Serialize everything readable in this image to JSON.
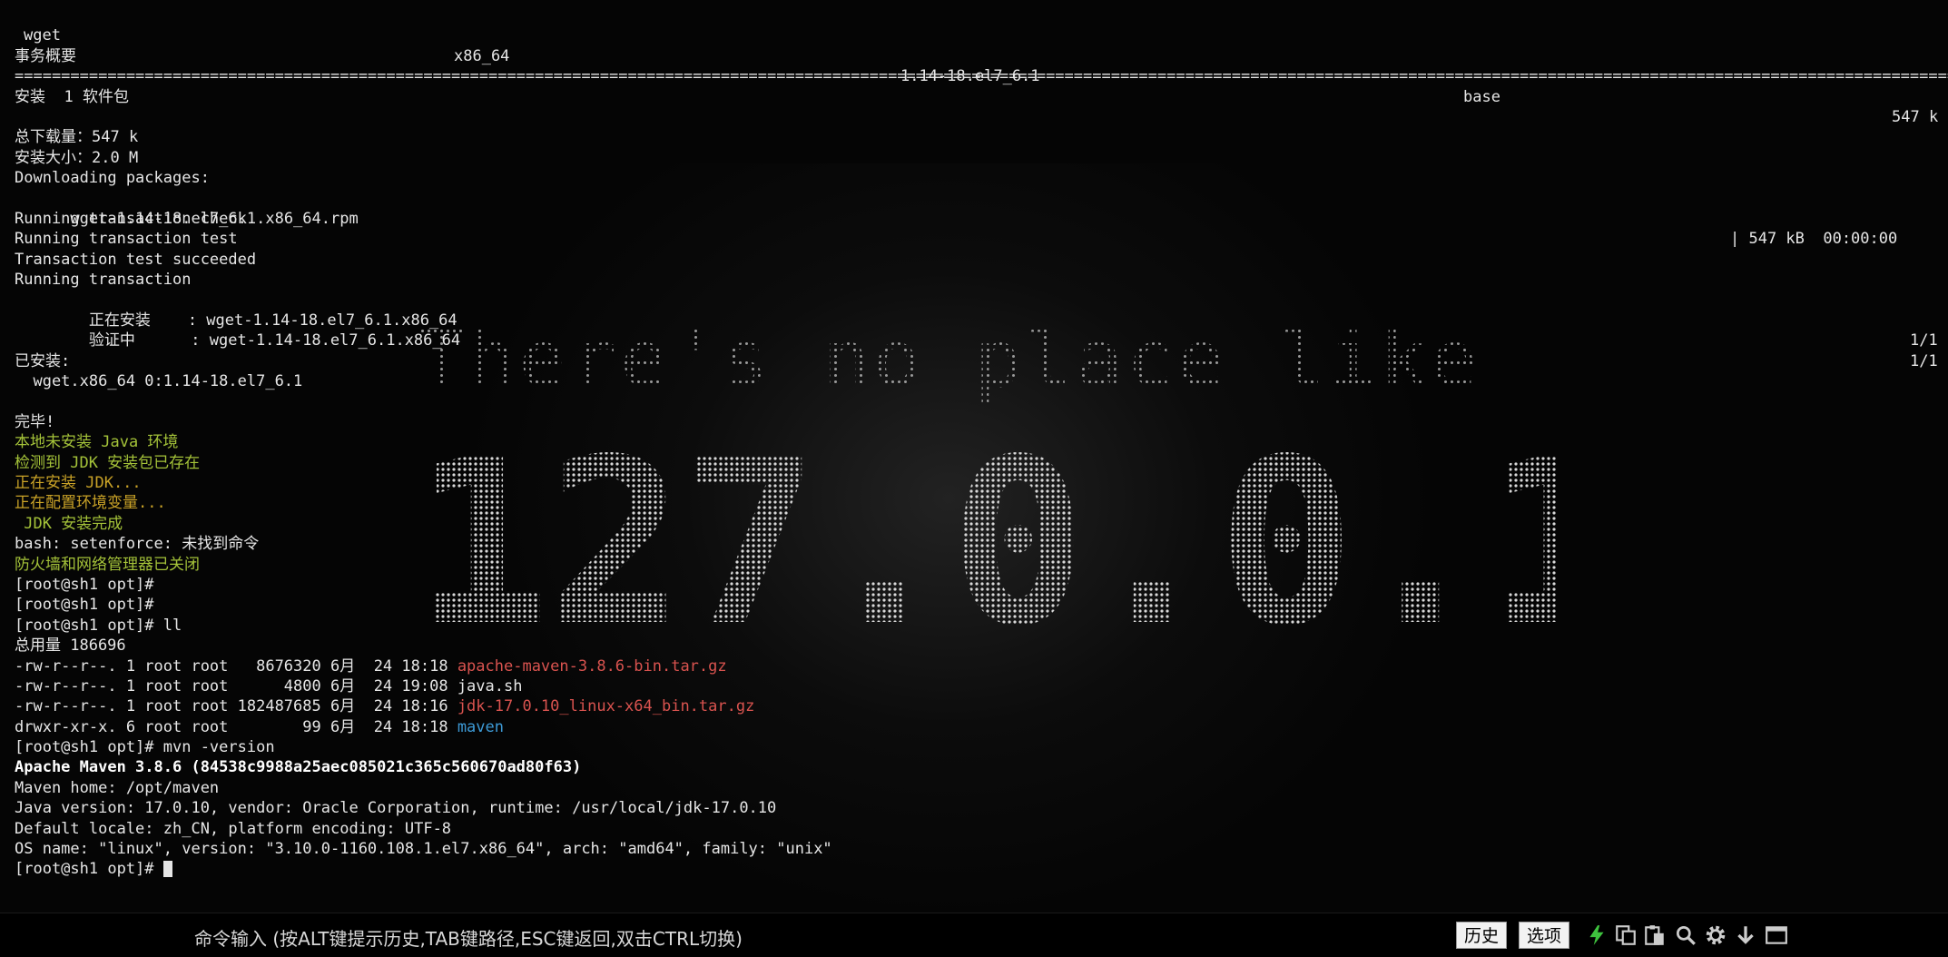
{
  "terminal": {
    "pkg_header": {
      "name": "wget",
      "arch": "x86_64",
      "version": "1.14-18.el7_6.1",
      "repo": "base",
      "size": "547 k"
    },
    "summary_title": "事务概要",
    "separator": "==================================================================================================================================================================================================================",
    "install_count": "安装  1 软件包",
    "total_download": "总下载量：547 k",
    "install_size": "安装大小：2.0 M",
    "downloading": "Downloading packages:",
    "rpm_file": "wget-1.14-18.el7_6.1.x86_64.rpm",
    "rpm_progress": "| 547 kB  00:00:00",
    "running_check": "Running transaction check",
    "running_test": "Running transaction test",
    "test_succeeded": "Transaction test succeeded",
    "running_tx": "Running transaction",
    "installing": "  正在安装    : wget-1.14-18.el7_6.1.x86_64",
    "installing_count": "1/1",
    "verifying": "  验证中      : wget-1.14-18.el7_6.1.x86_64",
    "verifying_count": "1/1",
    "installed_title": "已安装:",
    "installed_pkg": "  wget.x86_64 0:1.14-18.el7_6.1",
    "done": "完毕!",
    "java_missing": "本地未安装 Java 环境",
    "jdk_found": "检测到 JDK 安装包已存在",
    "jdk_installing": "正在安装 JDK...",
    "env_config": "正在配置环境变量...",
    "jdk_done": " JDK 安装完成",
    "setenforce": "bash: setenforce: 未找到命令",
    "firewall": "防火墙和网络管理器已关闭",
    "prompt1": "[root@sh1 opt]#",
    "prompt2": "[root@sh1 opt]#",
    "prompt_ll": "[root@sh1 opt]# ll",
    "total": "总用量 186696",
    "files": [
      {
        "meta": "-rw-r--r--. 1 root root   8676320 6月  24 18:18 ",
        "name": "apache-maven-3.8.6-bin.tar.gz",
        "color": "red"
      },
      {
        "meta": "-rw-r--r--. 1 root root      4800 6月  24 19:08 ",
        "name": "java.sh",
        "color": "normal"
      },
      {
        "meta": "-rw-r--r--. 1 root root 182487685 6月  24 18:16 ",
        "name": "jdk-17.0.10_linux-x64_bin.tar.gz",
        "color": "red"
      },
      {
        "meta": "drwxr-xr-x. 6 root root        99 6月  24 18:18 ",
        "name": "maven",
        "color": "blue"
      }
    ],
    "prompt_mvn": "[root@sh1 opt]# mvn -version",
    "maven_version": "Apache Maven 3.8.6 (84538c9988a25aec085021c365c560670ad80f63)",
    "maven_home": "Maven home: /opt/maven",
    "java_version": "Java version: 17.0.10, vendor: Oracle Corporation, runtime: /usr/local/jdk-17.0.10",
    "locale": "Default locale: zh_CN, platform encoding: UTF-8",
    "os_name": "OS name: \"linux\", version: \"3.10.0-1160.108.1.el7.x86_64\", arch: \"amd64\", family: \"unix\"",
    "prompt_last": "[root@sh1 opt]# "
  },
  "background_art": {
    "line1": "There's no place like",
    "line2": "127.0.0.1"
  },
  "cmdbar": {
    "hint": "命令输入 (按ALT键提示历史,TAB键路径,ESC键返回,双击CTRL切换)",
    "history_label": "历史",
    "options_label": "选项",
    "icons": [
      "lightning-icon",
      "copy-icon",
      "paste-icon",
      "search-icon",
      "gear-icon",
      "download-icon",
      "window-icon"
    ]
  },
  "colors": {
    "green": "#a4c239",
    "yellow": "#c9a227",
    "red": "#d9534f",
    "blue": "#3d9ad6",
    "bg": "#000000"
  }
}
